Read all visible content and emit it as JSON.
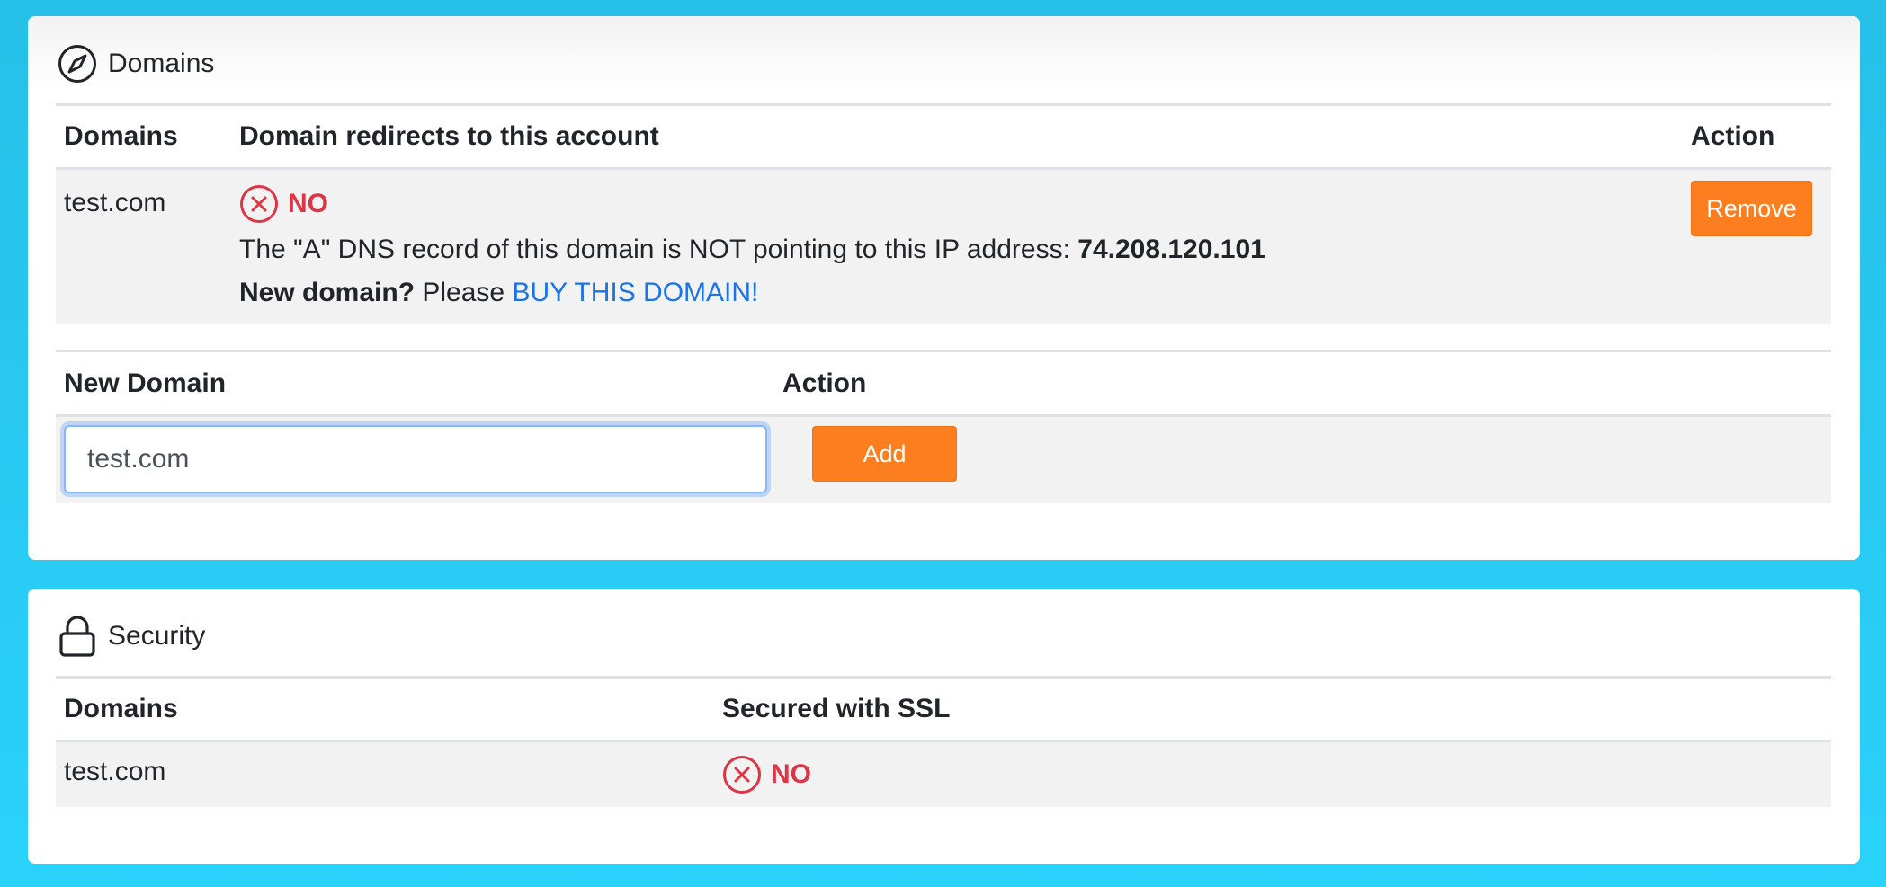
{
  "domains_card": {
    "title": "Domains",
    "icon": "compass-icon",
    "columns": {
      "domains": "Domains",
      "redirect": "Domain redirects to this account",
      "action": "Action"
    },
    "rows": [
      {
        "domain": "test.com",
        "status_text": "NO",
        "dns_message": "The \"A\" DNS record of this domain is NOT pointing to this IP address:",
        "ip_address": "74.208.120.101",
        "new_domain_label": "New domain?",
        "please_text": "Please",
        "buy_link_text": "BUY THIS DOMAIN!",
        "remove_label": "Remove"
      }
    ],
    "new_domain": {
      "column_new": "New Domain",
      "column_action": "Action",
      "input_value": "test.com",
      "add_label": "Add"
    }
  },
  "security_card": {
    "title": "Security",
    "icon": "lock-icon",
    "columns": {
      "domains": "Domains",
      "ssl": "Secured with SSL"
    },
    "rows": [
      {
        "domain": "test.com",
        "ssl_status": "NO"
      }
    ]
  },
  "colors": {
    "background": "#2ad2fb",
    "accent_orange": "#fd7e1f",
    "link_blue": "#1a73e8",
    "error_red": "#dc3545",
    "row_stripe": "#f2f2f2"
  }
}
